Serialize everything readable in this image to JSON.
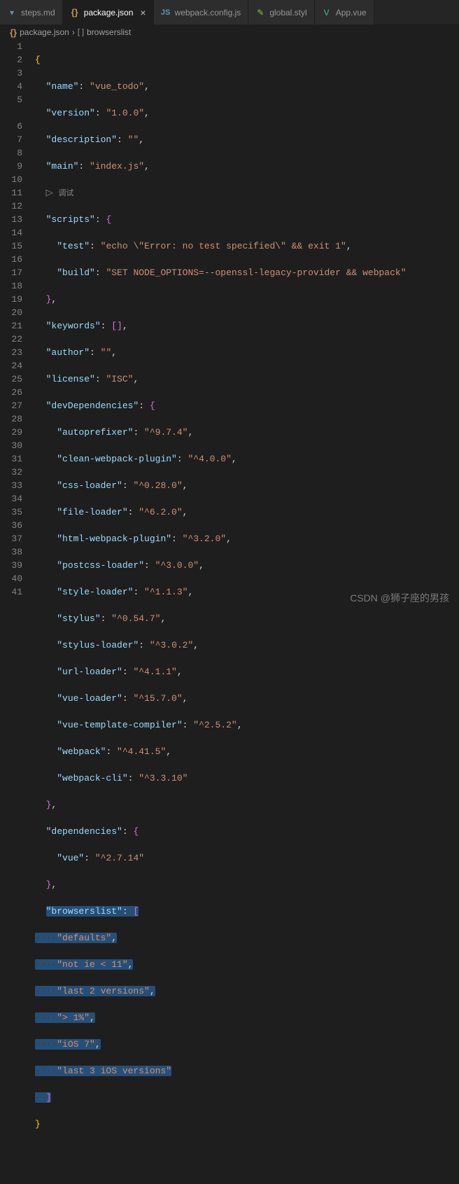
{
  "tabs": [
    {
      "icon": "md",
      "label": "steps.md"
    },
    {
      "icon": "json",
      "label": "package.json",
      "active": true
    },
    {
      "icon": "js",
      "label": "webpack.config.js"
    },
    {
      "icon": "styl",
      "label": "global.styl"
    },
    {
      "icon": "vue",
      "label": "App.vue"
    }
  ],
  "breadcrumb": {
    "file": "package.json",
    "path": "browserslist"
  },
  "debug_label": "调试",
  "code": {
    "name_k": "\"name\"",
    "name_v": "\"vue_todo\"",
    "version_k": "\"version\"",
    "version_v": "\"1.0.0\"",
    "description_k": "\"description\"",
    "description_v": "\"\"",
    "main_k": "\"main\"",
    "main_v": "\"index.js\"",
    "scripts_k": "\"scripts\"",
    "test_k": "\"test\"",
    "test_v": "\"echo \\\"Error: no test specified\\\" && exit 1\"",
    "build_k": "\"build\"",
    "build_v": "\"SET NODE_OPTIONS=--openssl-legacy-provider && webpack\"",
    "keywords_k": "\"keywords\"",
    "author_k": "\"author\"",
    "author_v": "\"\"",
    "license_k": "\"license\"",
    "license_v": "\"ISC\"",
    "devdeps_k": "\"devDependencies\"",
    "dd1k": "\"autoprefixer\"",
    "dd1v": "\"^9.7.4\"",
    "dd2k": "\"clean-webpack-plugin\"",
    "dd2v": "\"^4.0.0\"",
    "dd3k": "\"css-loader\"",
    "dd3v": "\"^0.28.0\"",
    "dd4k": "\"file-loader\"",
    "dd4v": "\"^6.2.0\"",
    "dd5k": "\"html-webpack-plugin\"",
    "dd5v": "\"^3.2.0\"",
    "dd6k": "\"postcss-loader\"",
    "dd6v": "\"^3.0.0\"",
    "dd7k": "\"style-loader\"",
    "dd7v": "\"^1.1.3\"",
    "dd8k": "\"stylus\"",
    "dd8v": "\"^0.54.7\"",
    "dd9k": "\"stylus-loader\"",
    "dd9v": "\"^3.0.2\"",
    "dd10k": "\"url-loader\"",
    "dd10v": "\"^4.1.1\"",
    "dd11k": "\"vue-loader\"",
    "dd11v": "\"^15.7.0\"",
    "dd12k": "\"vue-template-compiler\"",
    "dd12v": "\"^2.5.2\"",
    "dd13k": "\"webpack\"",
    "dd13v": "\"^4.41.5\"",
    "dd14k": "\"webpack-cli\"",
    "dd14v": "\"^3.3.10\"",
    "deps_k": "\"dependencies\"",
    "d1k": "\"vue\"",
    "d1v": "\"^2.7.14\"",
    "bl_k": "\"browserslist\"",
    "bl1": "\"defaults\"",
    "bl2": "\"not ie < 11\"",
    "bl3": "\"last 2 versions\"",
    "bl4": "\"> 1%\"",
    "bl5": "\"iOS 7\"",
    "bl6": "\"last 3 iOS versions\""
  },
  "watermark": "CSDN @狮子座的男孩"
}
